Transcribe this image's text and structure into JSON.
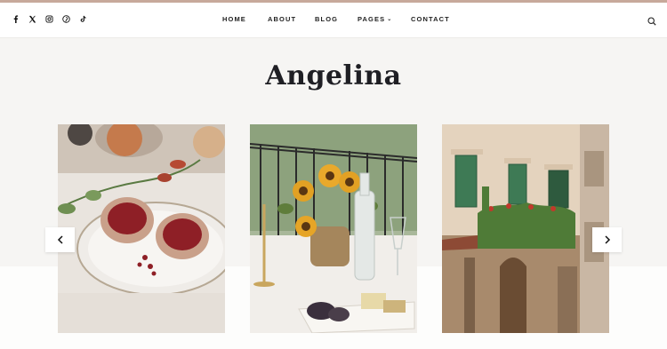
{
  "header": {
    "social": [
      {
        "name": "facebook-icon",
        "glyph": "f"
      },
      {
        "name": "x-twitter-icon",
        "glyph": "X"
      },
      {
        "name": "instagram-icon",
        "glyph": "ig"
      },
      {
        "name": "pinterest-icon",
        "glyph": "p"
      },
      {
        "name": "tiktok-icon",
        "glyph": "tt"
      }
    ],
    "nav": {
      "home": "Home",
      "about": "About",
      "blog": "Blog",
      "pages": "Pages",
      "contact": "Contact"
    }
  },
  "site": {
    "title": "Angelina"
  },
  "slider": {
    "slides": [
      {
        "subject": "pomegranate-plate-image"
      },
      {
        "subject": "sunflowers-table-image"
      },
      {
        "subject": "old-building-facade-image"
      }
    ]
  },
  "colors": {
    "accent_strip": "#c7a99b",
    "text": "#1f1f24",
    "background": "#f6f5f3"
  }
}
